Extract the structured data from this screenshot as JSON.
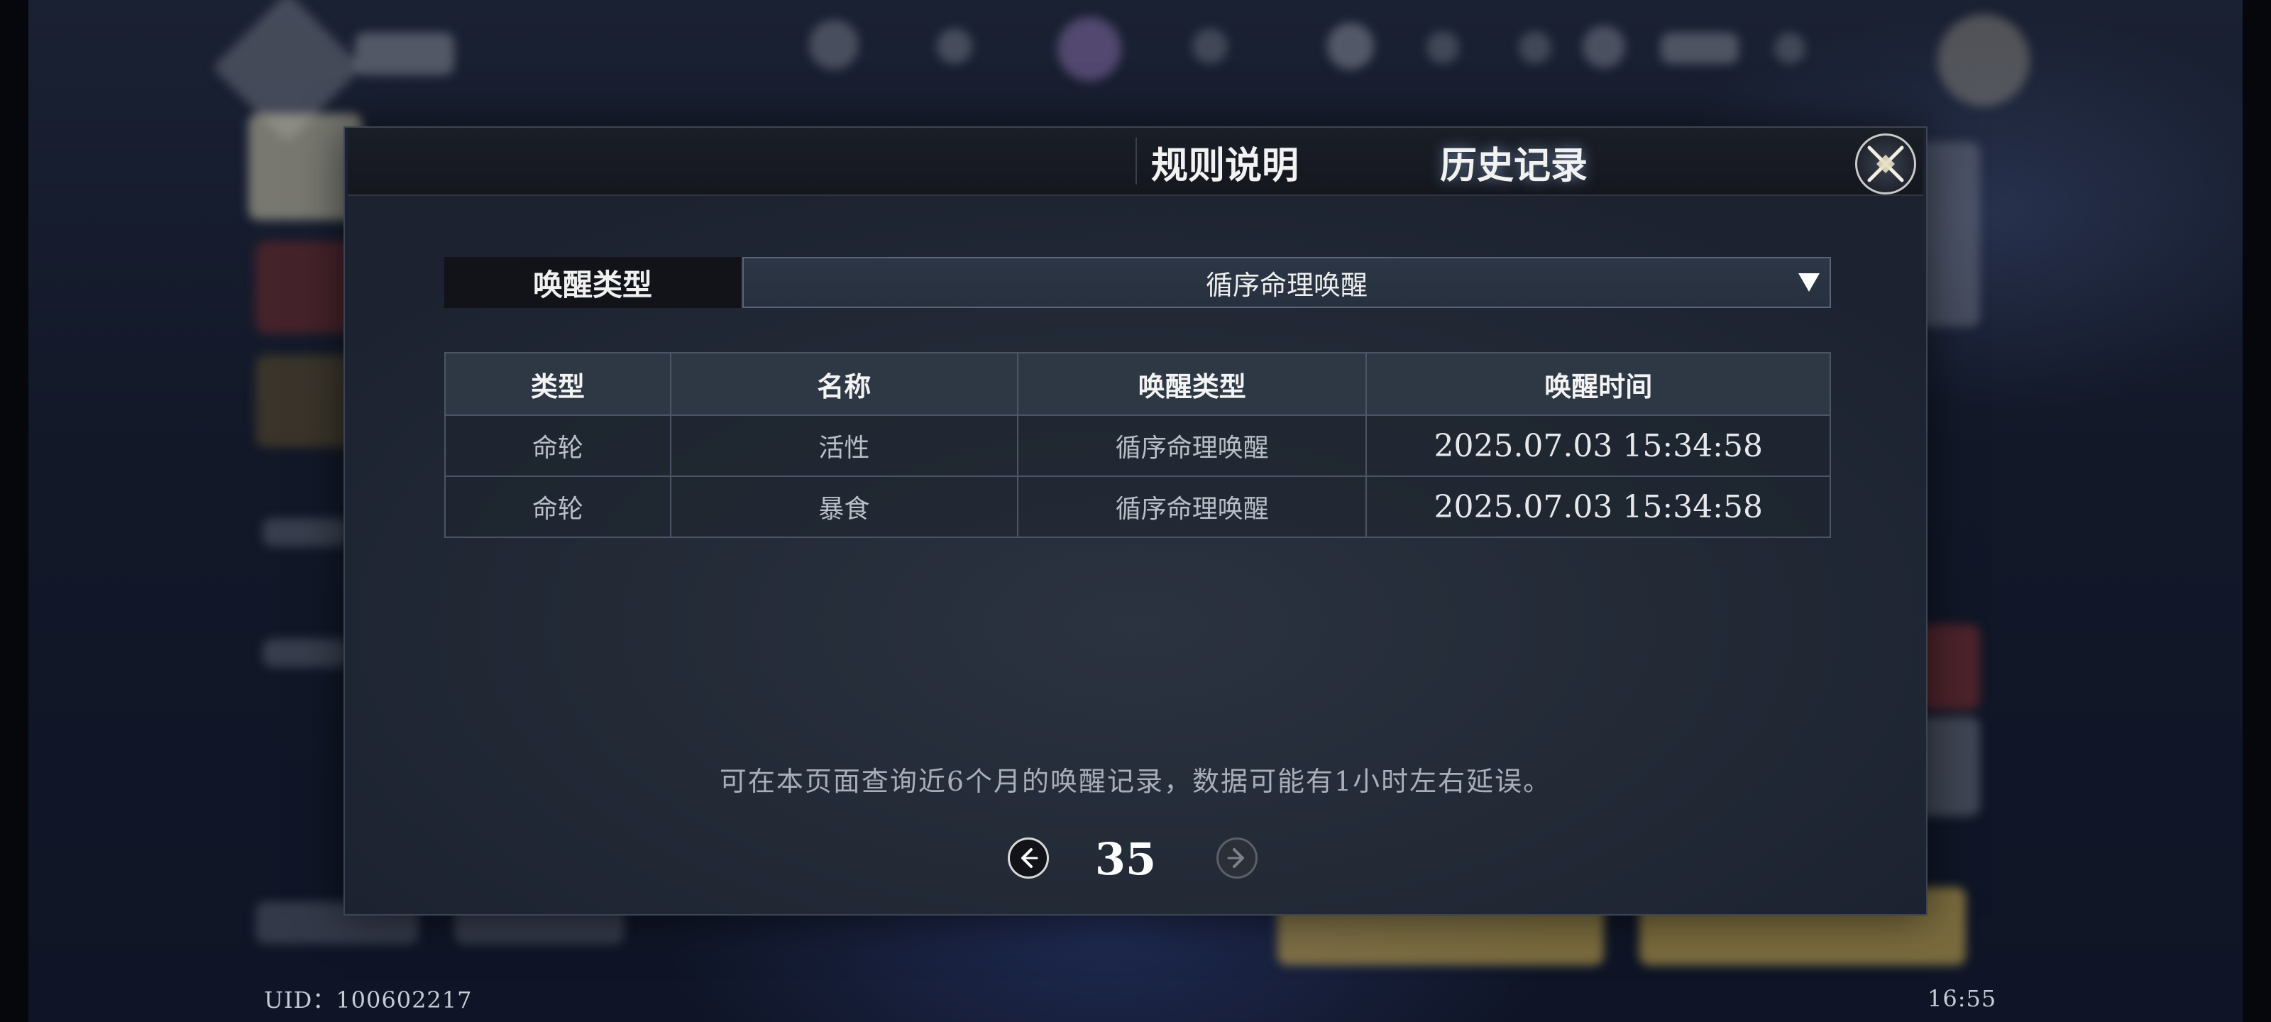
{
  "tabs": {
    "rules_label": "规则说明",
    "history_label": "历史记录"
  },
  "filter": {
    "label": "唤醒类型",
    "selected": "循序命理唤醒"
  },
  "table": {
    "headers": [
      "类型",
      "名称",
      "唤醒类型",
      "唤醒时间"
    ],
    "rows": [
      [
        "命轮",
        "活性",
        "循序命理唤醒",
        "2025.07.03 15:34:58"
      ],
      [
        "命轮",
        "暴食",
        "循序命理唤醒",
        "2025.07.03 15:34:58"
      ]
    ]
  },
  "note": "可在本页面查询近6个月的唤醒记录，数据可能有1小时左右延误。",
  "pagination": {
    "current_page": "35"
  },
  "footer": {
    "uid": "UID：100602217",
    "clock": "16:55"
  },
  "icons": {
    "close": "close-x-icon",
    "prev": "arrow-left-icon",
    "next": "arrow-right-icon",
    "dropdown": "caret-down-icon"
  },
  "colors": {
    "dialog_bg": "#232a36",
    "tab_bar_bg": "#14171e",
    "table_header_bg": "#2e3845",
    "table_border": "#4c5566",
    "text_primary": "#f2f2f2",
    "text_secondary": "#b9bec8"
  }
}
